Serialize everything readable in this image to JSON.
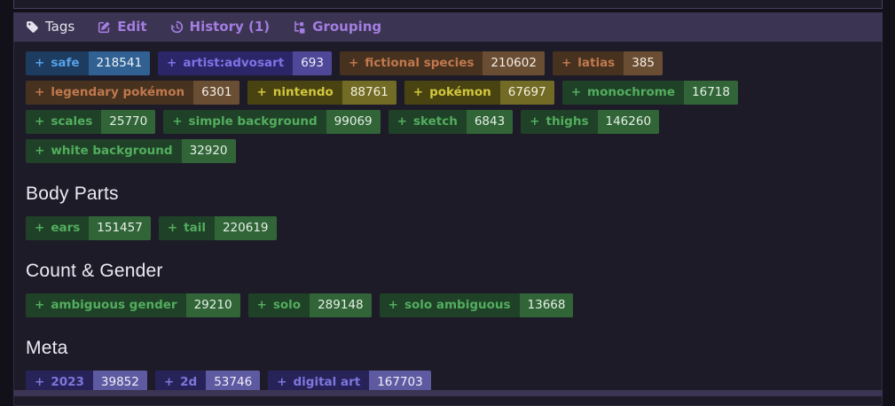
{
  "ui": {
    "plus_label": "+"
  },
  "nav": {
    "items": [
      {
        "label": "Tags",
        "icon": "tag-icon",
        "style": "plain"
      },
      {
        "label": "Edit",
        "icon": "pencil-square-icon",
        "style": "link"
      },
      {
        "label": "History (1)",
        "icon": "history-icon",
        "style": "link"
      },
      {
        "label": "Grouping",
        "icon": "grouping-icon",
        "style": "link"
      }
    ]
  },
  "sections": [
    {
      "title": "",
      "tags": [
        {
          "name": "safe",
          "count": "218541",
          "category": "rating"
        },
        {
          "name": "artist:advosart",
          "count": "693",
          "category": "artist"
        },
        {
          "name": "fictional species",
          "count": "210602",
          "category": "species"
        },
        {
          "name": "latias",
          "count": "385",
          "category": "species"
        },
        {
          "name": "legendary pokémon",
          "count": "6301",
          "category": "species"
        },
        {
          "name": "nintendo",
          "count": "88761",
          "category": "copyright"
        },
        {
          "name": "pokémon",
          "count": "67697",
          "category": "copyright"
        },
        {
          "name": "monochrome",
          "count": "16718",
          "category": "general"
        },
        {
          "name": "scales",
          "count": "25770",
          "category": "general"
        },
        {
          "name": "simple background",
          "count": "99069",
          "category": "general"
        },
        {
          "name": "sketch",
          "count": "6843",
          "category": "general"
        },
        {
          "name": "thighs",
          "count": "146260",
          "category": "general"
        },
        {
          "name": "white background",
          "count": "32920",
          "category": "general"
        }
      ]
    },
    {
      "title": "Body Parts",
      "tags": [
        {
          "name": "ears",
          "count": "151457",
          "category": "general"
        },
        {
          "name": "tail",
          "count": "220619",
          "category": "general"
        }
      ]
    },
    {
      "title": "Count & Gender",
      "tags": [
        {
          "name": "ambiguous gender",
          "count": "29210",
          "category": "general"
        },
        {
          "name": "solo",
          "count": "289148",
          "category": "general"
        },
        {
          "name": "solo ambiguous",
          "count": "13668",
          "category": "general"
        }
      ]
    },
    {
      "title": "Meta",
      "tags": [
        {
          "name": "2023",
          "count": "39852",
          "category": "meta"
        },
        {
          "name": "2d",
          "count": "53746",
          "category": "meta"
        },
        {
          "name": "digital art",
          "count": "167703",
          "category": "meta"
        }
      ]
    }
  ],
  "colors": {
    "page_bg": "#121018",
    "panel_bg": "#1e1b28",
    "header_bg": "#3b3452",
    "nav_link": "#a37de0",
    "nav_plain": "#e5e2ed",
    "categories": {
      "rating": {
        "bg": "#1e3c5f",
        "text": "#55a1e8",
        "count_bg": "#306192",
        "count_text": "#edf2f8"
      },
      "artist": {
        "bg": "#2b2668",
        "text": "#7e73e6",
        "count_bg": "#4f4899",
        "count_text": "#f0effa"
      },
      "species": {
        "bg": "#46321f",
        "text": "#c0784e",
        "count_bg": "#6a4e33",
        "count_text": "#f5eee6"
      },
      "copyright": {
        "bg": "#494312",
        "text": "#d2c73c",
        "count_bg": "#726b25",
        "count_text": "#f4f1dd"
      },
      "general": {
        "bg": "#1f4127",
        "text": "#53ad5e",
        "count_bg": "#316538",
        "count_text": "#e6efe6"
      },
      "meta": {
        "bg": "#272359",
        "text": "#7d77db",
        "count_bg": "#5e5aa2",
        "count_text": "#f0f0f6"
      }
    }
  }
}
